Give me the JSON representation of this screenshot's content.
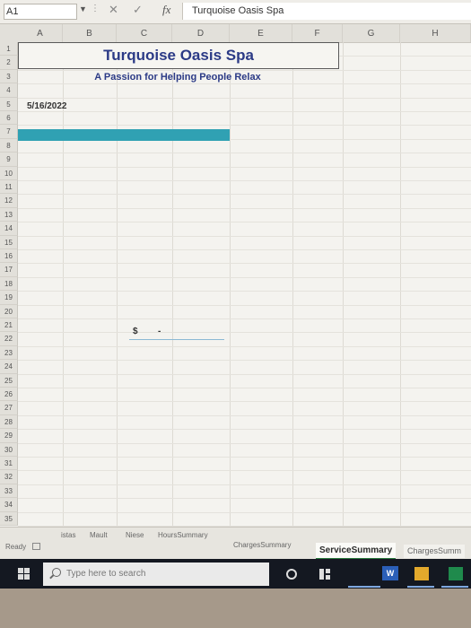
{
  "formula_bar": {
    "name_box": "A1",
    "fx_label": "fx",
    "cancel_glyph": "✕",
    "enter_glyph": "✓",
    "content": "Turquoise Oasis Spa"
  },
  "columns": [
    "A",
    "B",
    "C",
    "D",
    "E",
    "F",
    "G",
    "H"
  ],
  "rows": [
    "1",
    "2",
    "3",
    "4",
    "5",
    "6",
    "7",
    "8",
    "9",
    "10",
    "11",
    "12",
    "13",
    "14",
    "15",
    "16",
    "17",
    "18",
    "19",
    "20",
    "21",
    "22",
    "23",
    "24",
    "25",
    "26",
    "27",
    "28",
    "29",
    "30",
    "31",
    "32",
    "33",
    "34",
    "35"
  ],
  "sheet": {
    "title": "Turquoise Oasis Spa",
    "subtitle": "A Passion for Helping People Relax",
    "date": "5/16/2022",
    "currency_symbol": "$",
    "currency_value": "-",
    "teal_band_color": "#30a1b3",
    "title_color": "#2b3a86"
  },
  "status": {
    "ready": "Ready"
  },
  "sheet_tabs": [
    "istas",
    "Mault",
    "Niese",
    "HoursSummary",
    "ChargesSummary",
    "ServiceSummary",
    "ChargesSumm"
  ],
  "active_tab": "ServiceSummary",
  "taskbar": {
    "search_placeholder": "Type here to search",
    "word_label": "W"
  }
}
